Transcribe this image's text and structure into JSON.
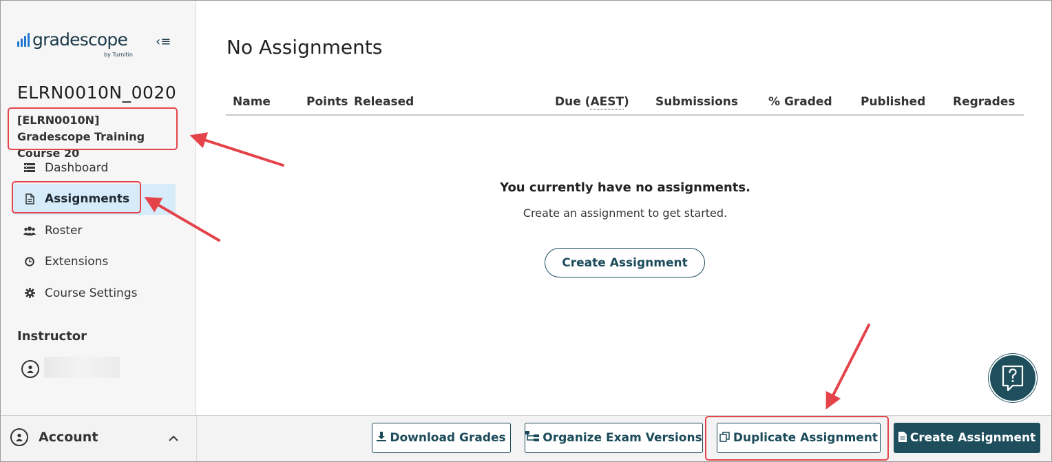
{
  "brand": {
    "logo_text": "gradescope",
    "logo_sub": "by Turnitin",
    "collapse_glyph": "‹≡"
  },
  "course": {
    "code": "ELRN0010N_0020",
    "name": "[ELRN0010N] Gradescope Training Course 20"
  },
  "sidebar": {
    "items": [
      {
        "label": "Dashboard",
        "icon": "dashboard-icon",
        "active": false
      },
      {
        "label": "Assignments",
        "icon": "document-icon",
        "active": true
      },
      {
        "label": "Roster",
        "icon": "users-icon",
        "active": false
      },
      {
        "label": "Extensions",
        "icon": "clock-icon",
        "active": false
      },
      {
        "label": "Course Settings",
        "icon": "gear-icon",
        "active": false
      }
    ],
    "instructor_label": "Instructor"
  },
  "account": {
    "label": "Account"
  },
  "main": {
    "title": "No Assignments",
    "columns": {
      "name": "Name",
      "points": "Points",
      "released": "Released",
      "due_prefix": "Due (",
      "due_abbr": "AEST",
      "due_suffix": ")",
      "submissions": "Submissions",
      "graded": "% Graded",
      "published": "Published",
      "regrades": "Regrades"
    },
    "empty_title": "You currently have no assignments.",
    "empty_sub": "Create an assignment to get started.",
    "empty_button": "Create Assignment"
  },
  "actions": {
    "download_grades": "Download Grades",
    "organize_exam_versions": "Organize Exam Versions",
    "duplicate_assignment": "Duplicate Assignment",
    "create_assignment": "Create Assignment"
  },
  "colors": {
    "accent": "#1e4d5c",
    "active_nav": "#d6ecfa",
    "highlight": "#e4434a",
    "logo_blue": "#1f77d0"
  }
}
